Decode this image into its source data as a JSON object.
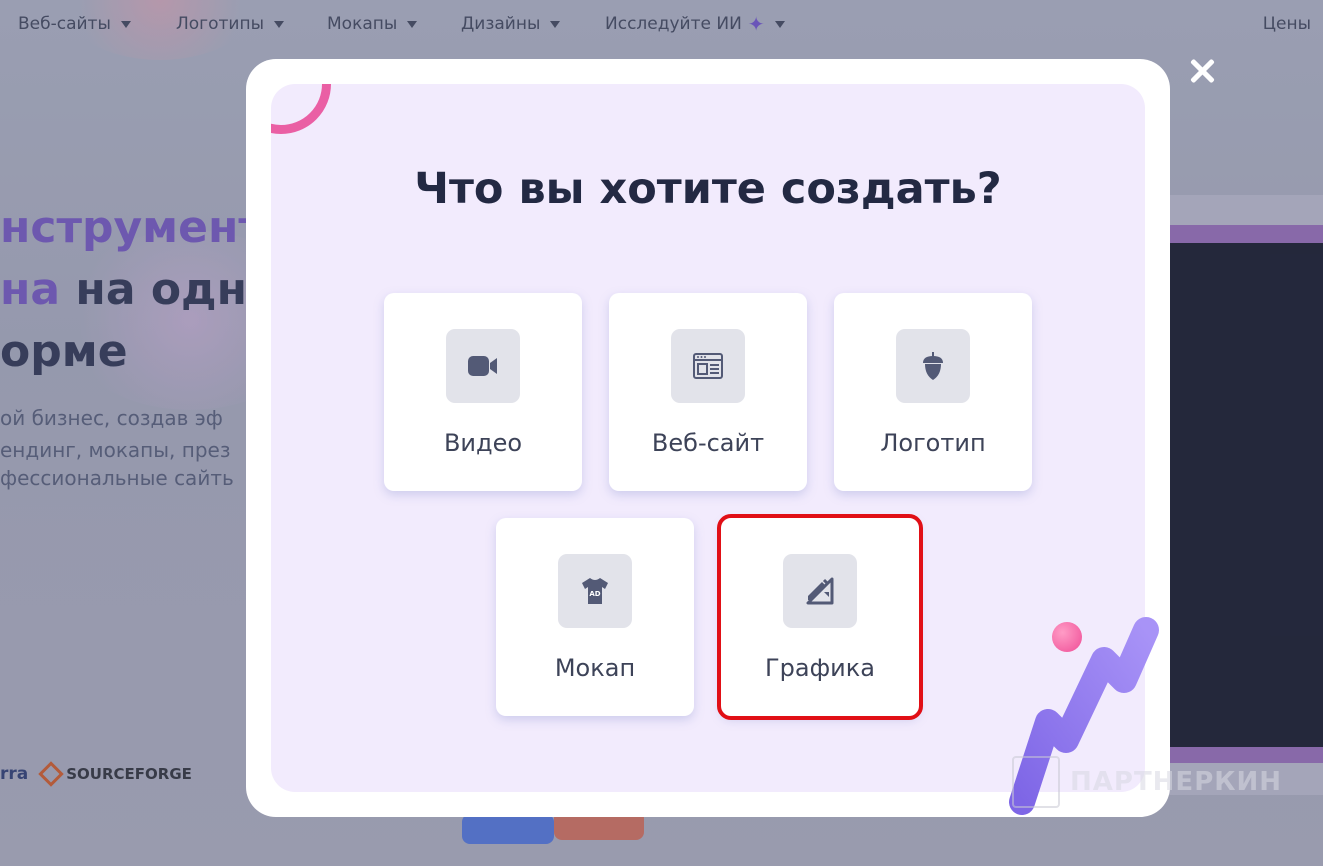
{
  "nav": {
    "items": [
      {
        "label": "Веб-сайты"
      },
      {
        "label": "Логотипы"
      },
      {
        "label": "Мокапы"
      },
      {
        "label": "Дизайны"
      },
      {
        "label": "Исследуйте ИИ"
      }
    ],
    "pricing": "Цены"
  },
  "hero": {
    "line1": "нструмент",
    "line2_accent": "на",
    "line2_rest": " на одно",
    "line3": "орме",
    "sub1": "ой бизнес, создав эф",
    "sub2": "ендинг, мокапы, през",
    "sub3": "фессиональные сайть"
  },
  "partners": {
    "capterra": "rra",
    "sourceforge": "SOURCEFORGE"
  },
  "modal": {
    "title": "Что вы хотите создать?",
    "options": [
      {
        "label": "Видео",
        "icon": "video-icon"
      },
      {
        "label": "Веб-сайт",
        "icon": "website-icon"
      },
      {
        "label": "Логотип",
        "icon": "acorn-logo-icon"
      },
      {
        "label": "Мокап",
        "icon": "tshirt-icon"
      },
      {
        "label": "Графика",
        "icon": "pen-ruler-icon"
      }
    ],
    "highlight_color": "#e10f16"
  },
  "watermark": "ПАРТНЕРКИН",
  "colors": {
    "accent": "#6d52b8",
    "modal_bg": "#f2ebfd",
    "title": "#232943"
  }
}
